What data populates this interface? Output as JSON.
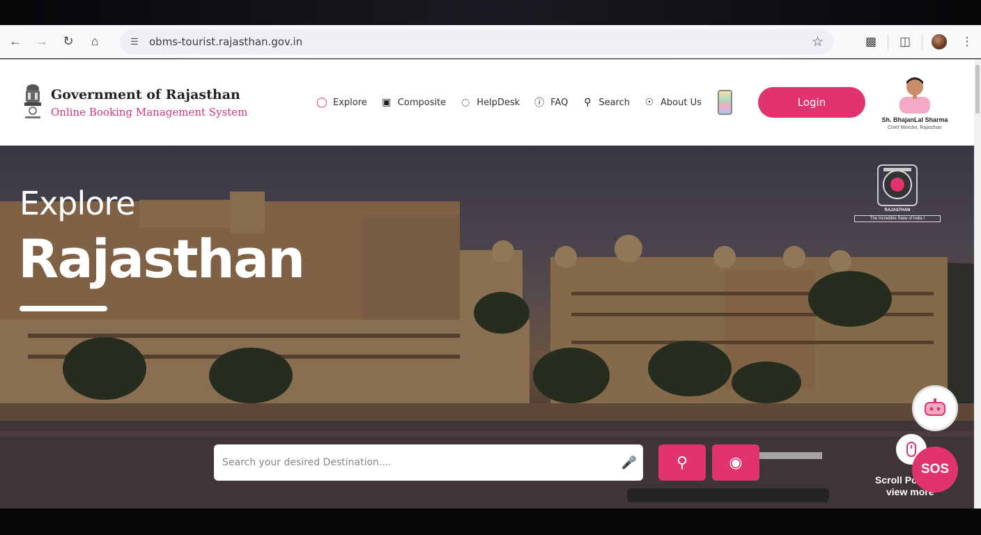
{
  "browser": {
    "url": "obms-tourist.rajasthan.gov.in",
    "icons": [
      "back-icon",
      "forward-icon",
      "reload-icon",
      "home-icon",
      "tune-icon",
      "star-icon",
      "extensions-icon",
      "cast-icon",
      "profile-avatar",
      "more-icon"
    ]
  },
  "header": {
    "org_title": "Government of Rajasthan",
    "org_subtitle": "Online Booking Management System",
    "nav": [
      {
        "label": "Explore",
        "icon": "compass-icon"
      },
      {
        "label": "Composite",
        "icon": "briefcase-icon"
      },
      {
        "label": "HelpDesk",
        "icon": "chat-icon"
      },
      {
        "label": "FAQ",
        "icon": "question-icon"
      },
      {
        "label": "Search",
        "icon": "search-icon"
      },
      {
        "label": "About Us",
        "icon": "info-icon"
      }
    ],
    "login_label": "Login",
    "cm_name": "Sh. BhajanLal Sharma",
    "cm_role": "Chief Minister, Rajasthan"
  },
  "hero": {
    "line1": "Explore",
    "line2": "Rajasthan",
    "logo_name": "RAJASTHAN",
    "logo_tagline": "The Incredible State of India !",
    "search_placeholder": "Search your desired Destination....",
    "scroll_text_line1": "Scroll Po",
    "scroll_text_line2": "view more",
    "sos_label": "SOS"
  },
  "colors": {
    "accent": "#e0336f",
    "subtitle": "#d6357b"
  }
}
